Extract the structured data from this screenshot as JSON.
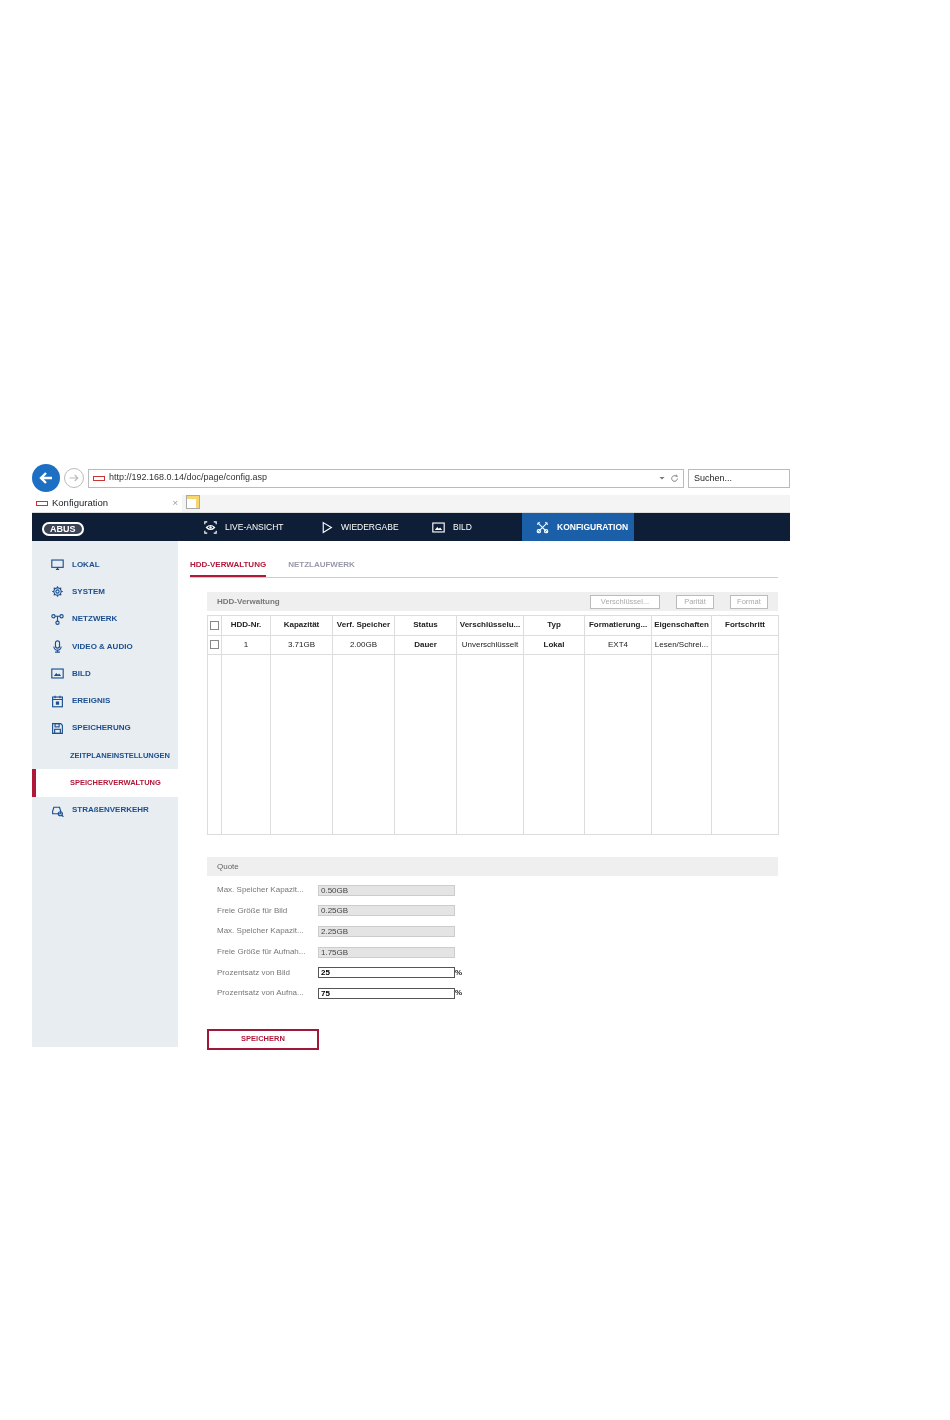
{
  "browser": {
    "url": "http://192.168.0.14/doc/page/config.asp",
    "search": {
      "placeholder": "Suchen..."
    },
    "tab": {
      "title": "Konfiguration",
      "close": "×"
    }
  },
  "navbar": {
    "logo": "ABUS",
    "items": [
      {
        "label": "LIVE-ANSICHT",
        "selected": false
      },
      {
        "label": "WIEDERGABE",
        "selected": false
      },
      {
        "label": "BILD",
        "selected": false
      },
      {
        "label": "KONFIGURATION",
        "selected": true
      }
    ]
  },
  "sidebar": {
    "items": [
      {
        "label": "LOKAL"
      },
      {
        "label": "SYSTEM"
      },
      {
        "label": "NETZWERK"
      },
      {
        "label": "VIDEO & AUDIO"
      },
      {
        "label": "BILD"
      },
      {
        "label": "EREIGNIS"
      },
      {
        "label": "SPEICHERUNG",
        "children": [
          {
            "label": "ZEITPLANEINSTELLUNGEN",
            "selected": false
          },
          {
            "label": "SPEICHERVERWALTUNG",
            "selected": true
          }
        ]
      },
      {
        "label": "STRAßENVERKEHR"
      }
    ]
  },
  "tabs": [
    {
      "label": "HDD-VERWALTUNG",
      "selected": true
    },
    {
      "label": "NETZLAUFWERK",
      "selected": false
    }
  ],
  "hdd_panel": {
    "title": "HDD-Verwaltung",
    "buttons": [
      {
        "label": "Verschlüssel...",
        "disabled": true
      },
      {
        "label": "Parität",
        "disabled": true
      },
      {
        "label": "Format",
        "disabled": true
      }
    ],
    "table": {
      "select_all_checked": false,
      "columns": [
        "HDD-Nr.",
        "Kapazität",
        "Verf. Speicher",
        "Status",
        "Verschlüsselu...",
        "Typ",
        "Formatierung...",
        "Eigenschaften",
        "Fortschritt"
      ],
      "rows": [
        {
          "checked": false,
          "cells": [
            "1",
            "3.71GB",
            "2.00GB",
            "Dauer",
            "Unverschlüsselt",
            "Lokal",
            "EXT4",
            "Lesen/Schrei...",
            ""
          ]
        }
      ]
    }
  },
  "quota": {
    "title": "Quote",
    "fields": [
      {
        "label": "Max. Speicher Kapazit...",
        "value": "0.50GB",
        "kind": "readonly"
      },
      {
        "label": "Freie Größe für Bild",
        "value": "0.25GB",
        "kind": "readonly"
      },
      {
        "label": "Max. Speicher Kapazit...",
        "value": "2.25GB",
        "kind": "readonly"
      },
      {
        "label": "Freie Größe für Aufnah...",
        "value": "1.75GB",
        "kind": "readonly"
      },
      {
        "label": "Prozentsatz von Bild",
        "value": "25",
        "kind": "input",
        "unit": "%"
      },
      {
        "label": "Prozentsatz von Aufna...",
        "value": "75",
        "kind": "input",
        "unit": "%"
      }
    ]
  },
  "save_button": "SPEICHERN"
}
